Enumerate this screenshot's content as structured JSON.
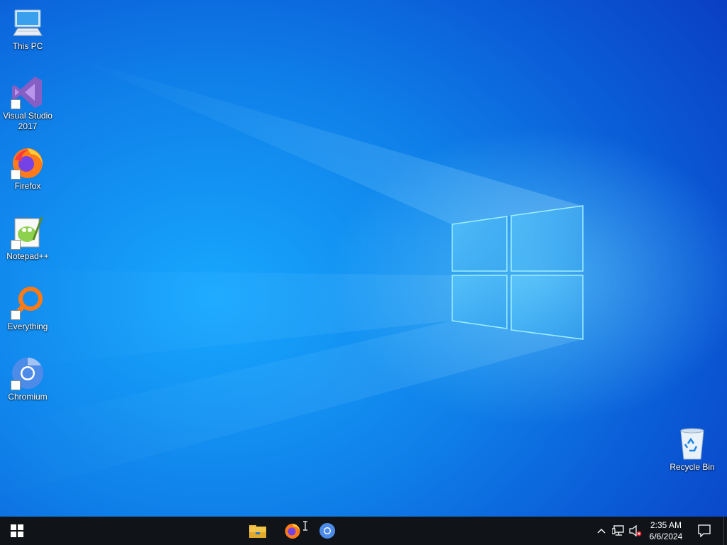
{
  "desktop": {
    "icons": [
      {
        "label": "This PC",
        "icon": "computer-icon"
      },
      {
        "label": "Visual Studio\n2017",
        "icon": "visual-studio-icon"
      },
      {
        "label": "Firefox",
        "icon": "firefox-icon"
      },
      {
        "label": "Notepad++",
        "icon": "notepad-plus-plus-icon"
      },
      {
        "label": "Everything",
        "icon": "everything-search-icon"
      },
      {
        "label": "Chromium",
        "icon": "chromium-icon"
      },
      {
        "label": "Recycle Bin",
        "icon": "recycle-bin-icon"
      }
    ]
  },
  "taskbar": {
    "start_icon": "windows-start-icon",
    "pinned": [
      "file-explorer-icon",
      "firefox-icon",
      "chromium-icon"
    ],
    "tray": [
      "chevron-up-icon",
      "network-icon",
      "volume-muted-icon"
    ],
    "time": "2:35 AM",
    "date": "6/6/2024",
    "notifications_icon": "action-center-icon"
  },
  "colors": {
    "taskbar_bg": "#101418",
    "wallpaper_primary": "#0f7fe8",
    "window_logo": "#7fe6ff"
  }
}
